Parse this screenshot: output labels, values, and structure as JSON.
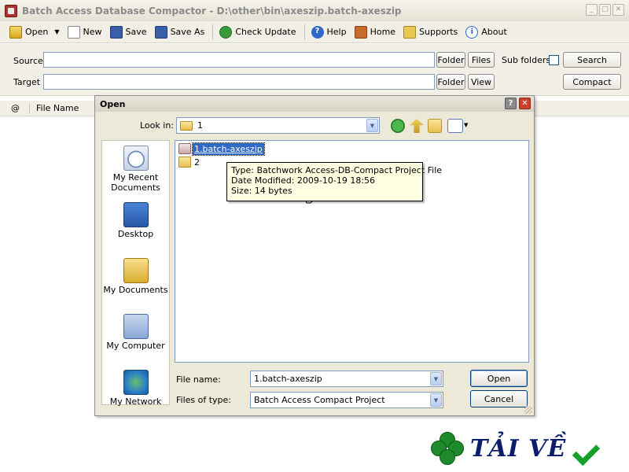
{
  "window": {
    "title": "Batch Access Database Compactor - D:\\other\\bin\\axeszip.batch-axeszip",
    "minimize": "_",
    "maximize": "□",
    "close": "✕"
  },
  "toolbar": {
    "open": "Open",
    "new": "New",
    "save": "Save",
    "save_as": "Save As",
    "check_update": "Check Update",
    "help": "Help",
    "home": "Home",
    "supports": "Supports",
    "about": "About",
    "icons": [
      "open-folder-icon",
      "new-file-icon",
      "save-icon",
      "save-as-icon",
      "check-update-icon",
      "help-icon",
      "home-icon",
      "supports-icon",
      "about-icon"
    ]
  },
  "form": {
    "source_label": "Source",
    "source_value": "",
    "target_label": "Target",
    "target_value": "",
    "folder_button": "Folder",
    "files_button": "Files",
    "view_button": "View",
    "subfolders_label": "Sub folders",
    "search_button": "Search",
    "compact_button": "Compact"
  },
  "list": {
    "columns": [
      "@",
      "File Name"
    ]
  },
  "dialog": {
    "title": "Open",
    "help_btn": "?",
    "close_btn": "✕",
    "look_in_label": "Look in:",
    "look_in_value": "1",
    "places": [
      {
        "line1": "My Recent",
        "line2": "Documents"
      },
      {
        "line1": "Desktop",
        "line2": ""
      },
      {
        "line1": "My Documents",
        "line2": ""
      },
      {
        "line1": "My Computer",
        "line2": ""
      },
      {
        "line1": "My Network",
        "line2": ""
      }
    ],
    "files": [
      {
        "name": "1.batch-axeszip",
        "type": "project",
        "selected": true
      },
      {
        "name": "2",
        "type": "folder",
        "selected": false
      }
    ],
    "tooltip": {
      "type": "Type: Batchwork Access-DB-Compact Project File",
      "modified": "Date Modified: 2009-10-19 18:56",
      "size": "Size: 14 bytes"
    },
    "file_name_label": "File name:",
    "file_name_value": "1.batch-axeszip",
    "file_type_label": "Files of type:",
    "file_type_value": "Batch Access Compact Project",
    "open_button": "Open",
    "cancel_button": "Cancel"
  },
  "watermark": {
    "text": "TẢI VỀ"
  }
}
